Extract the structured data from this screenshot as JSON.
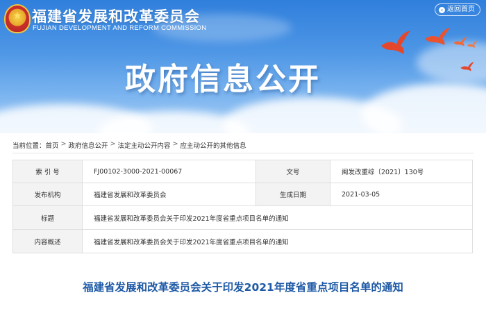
{
  "header": {
    "org_name_cn": "福建省发展和改革委员会",
    "org_name_en": "FUJIAN DEVELOPMENT AND REFORM COMMISSION",
    "back_label": "返回首页",
    "banner_title": "政府信息公开"
  },
  "breadcrumb": {
    "prefix": "当前位置：",
    "items": [
      "首页",
      "政府信息公开",
      "法定主动公开内容",
      "应主动公开的其他信息"
    ]
  },
  "meta": {
    "index_label": "索 引 号",
    "index_value": "FJ00102-3000-2021-00067",
    "doc_no_label": "文号",
    "doc_no_value": "闽发改重综〔2021〕130号",
    "issuer_label": "发布机构",
    "issuer_value": "福建省发展和改革委员会",
    "date_label": "生成日期",
    "date_value": "2021-03-05",
    "title_label": "标题",
    "title_value": "福建省发展和改革委员会关于印发2021年度省重点项目名单的通知",
    "summary_label": "内容概述",
    "summary_value": "福建省发展和改革委员会关于印发2021年度省重点项目名单的通知"
  },
  "article": {
    "title": "福建省发展和改革委员会关于印发2021年度省重点项目名单的通知"
  },
  "colors": {
    "title_blue": "#1f5aa6",
    "banner_blue": "#3a86d9",
    "bird_red": "#e4472b"
  }
}
